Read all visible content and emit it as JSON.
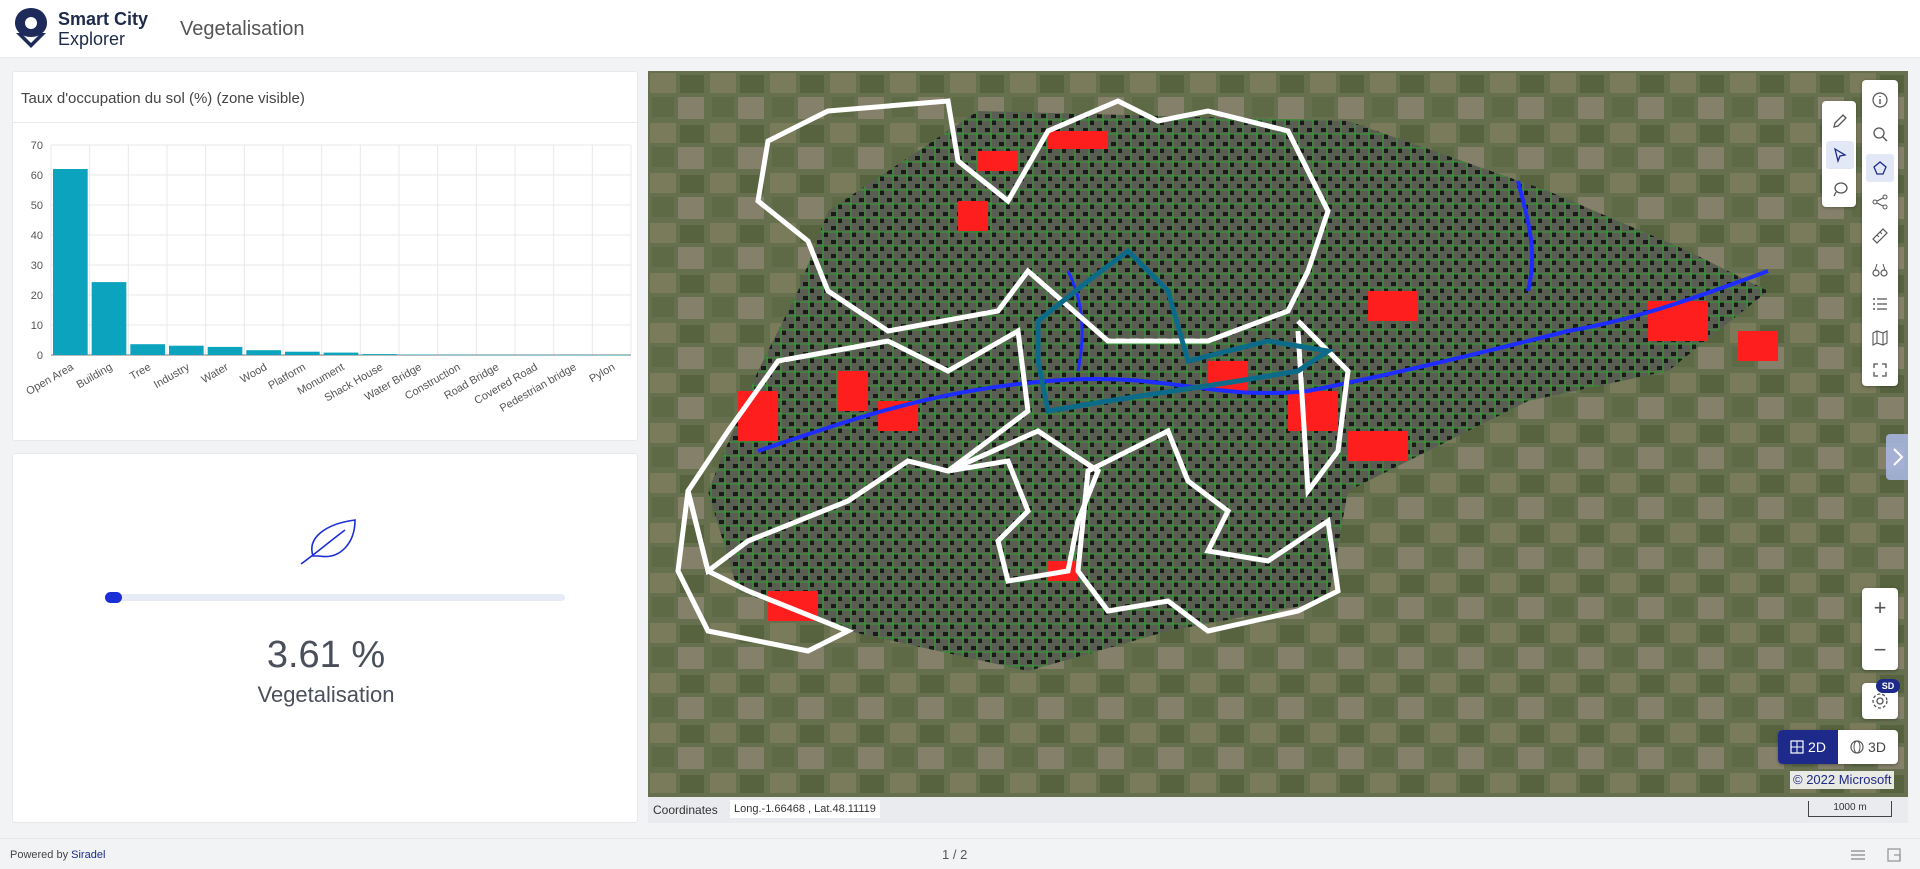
{
  "header": {
    "brand_line1": "Smart City",
    "brand_line2": "Explorer",
    "page_title": "Vegetalisation"
  },
  "chart_card": {
    "title": "Taux d'occupation du sol (%) (zone visible)"
  },
  "chart_data": {
    "type": "bar",
    "categories": [
      "Open Area",
      "Building",
      "Tree",
      "Industry",
      "Water",
      "Wood",
      "Platform",
      "Monument",
      "Shack House",
      "Water Bridge",
      "Construction",
      "Road Bridge",
      "Covered Road",
      "Pedestrian bridge",
      "Pylon"
    ],
    "values": [
      62,
      24.3,
      3.6,
      3.1,
      2.7,
      1.6,
      1.1,
      0.8,
      0.3,
      0.15,
      0.1,
      0.08,
      0.05,
      0.04,
      0.02
    ],
    "ylim": [
      0,
      70
    ],
    "yticks": [
      0,
      10,
      20,
      30,
      40,
      50,
      60,
      70
    ],
    "grid": true,
    "color": "#0ba3bd"
  },
  "vegetalisation": {
    "value_text": "3.61 %",
    "value": 3.61,
    "label": "Vegetalisation"
  },
  "map": {
    "mode_2d": "2D",
    "mode_3d": "3D",
    "sd_badge": "SD",
    "copyright": "© 2022 Microsoft",
    "coords_label": "Coordinates",
    "coords_value": "Long.-1.66468 , Lat.48.11119",
    "scale": "1000 m",
    "zoom_in": "+",
    "zoom_out": "−"
  },
  "footer": {
    "powered_by": "Powered by",
    "powered_link": "Siradel",
    "pager": "1 / 2"
  },
  "colors": {
    "brand": "#1d2a8a",
    "bar": "#0ba3bd",
    "progress": "#1b2fd6"
  }
}
